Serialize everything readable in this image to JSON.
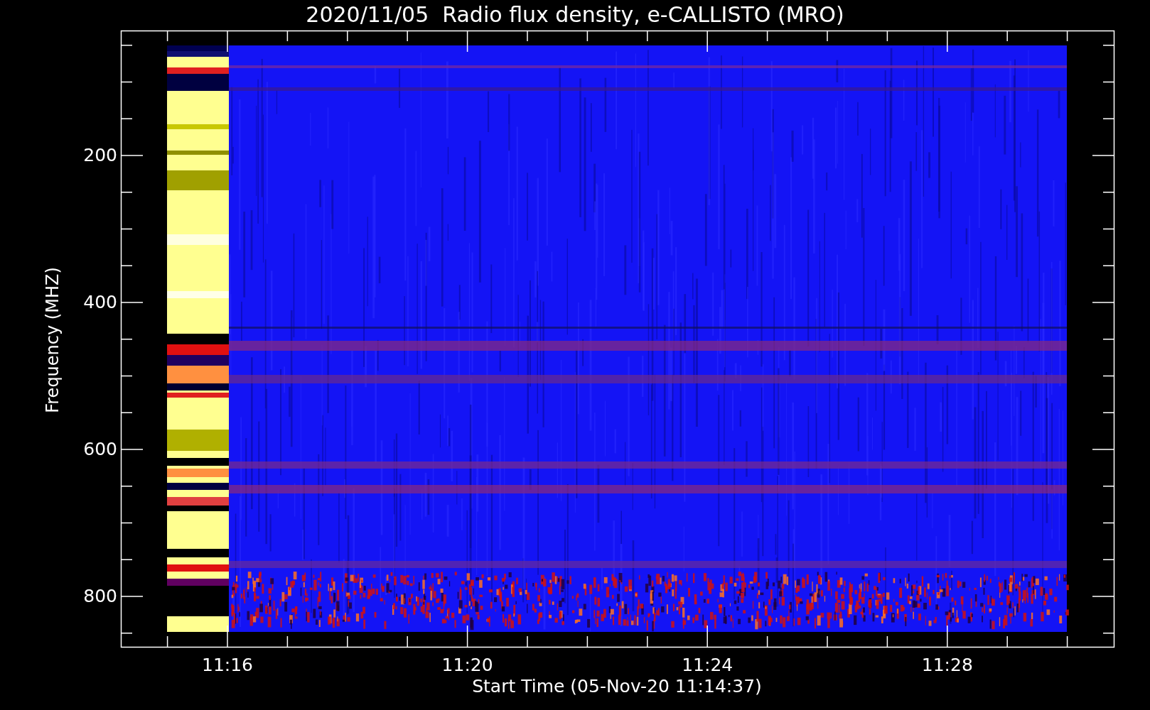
{
  "title": "2020/11/05  Radio flux density, e-CALLISTO (MRO)",
  "y_axis": {
    "label": "Frequency (MHZ)",
    "ticks": [
      "200",
      "400",
      "600",
      "800"
    ]
  },
  "x_axis": {
    "label": "Start Time (05-Nov-20 11:14:37)",
    "ticks": [
      "11:16",
      "11:20",
      "11:24",
      "11:28"
    ]
  }
}
